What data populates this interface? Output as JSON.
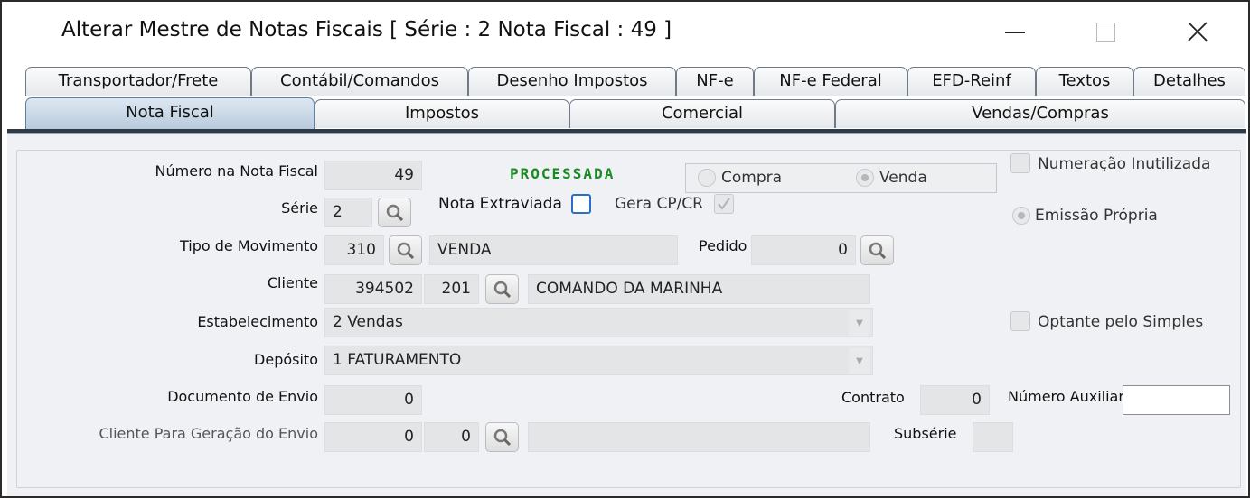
{
  "window": {
    "title": "Alterar Mestre de Notas Fiscais [ Série : 2   Nota Fiscal : 49 ]"
  },
  "tabs_row1": [
    "Transportador/Frete",
    "Contábil/Comandos",
    "Desenho Impostos",
    "NF-e",
    "NF-e Federal",
    "EFD-Reinf",
    "Textos",
    "Detalhes"
  ],
  "tabs_row2": [
    "Nota Fiscal",
    "Impostos",
    "Comercial",
    "Vendas/Compras"
  ],
  "active_tab": "Nota Fiscal",
  "form": {
    "numero_label": "Número na Nota Fiscal",
    "numero_value": "49",
    "status": "PROCESSADA",
    "compra_label": "Compra",
    "venda_label": "Venda",
    "selected_type": "Venda",
    "numeracao_inutilizada_label": "Numeração Inutilizada",
    "serie_label": "Série",
    "serie_value": "2",
    "nota_extraviada_label": "Nota Extraviada",
    "gera_cpcr_label": "Gera CP/CR",
    "emissao_propria_label": "Emissão Própria",
    "tipo_mov_label": "Tipo de Movimento",
    "tipo_mov_code": "310",
    "tipo_mov_desc": "VENDA",
    "pedido_label": "Pedido",
    "pedido_value": "0",
    "cliente_label": "Cliente",
    "cliente_code": "394502",
    "cliente_sub": "201",
    "cliente_name": "COMANDO DA MARINHA",
    "estabelecimento_label": "Estabelecimento",
    "estabelecimento_value": "2 Vendas",
    "optante_simples_label": "Optante pelo Simples",
    "deposito_label": "Depósito",
    "deposito_value": "1 FATURAMENTO",
    "doc_envio_label": "Documento de Envio",
    "doc_envio_value": "0",
    "contrato_label": "Contrato",
    "contrato_value": "0",
    "num_aux_label": "Número Auxiliar",
    "num_aux_value": "",
    "cliente_envio_label": "Cliente Para Geração do Envio",
    "cliente_envio_code": "0",
    "cliente_envio_sub": "0",
    "cliente_envio_name": "",
    "subserie_label": "Subsérie",
    "subserie_value": ""
  },
  "colors": {
    "status_green": "#1a8a24",
    "active_tab": "#c9d8e7",
    "checkbox_focus": "#2b6fc2"
  }
}
